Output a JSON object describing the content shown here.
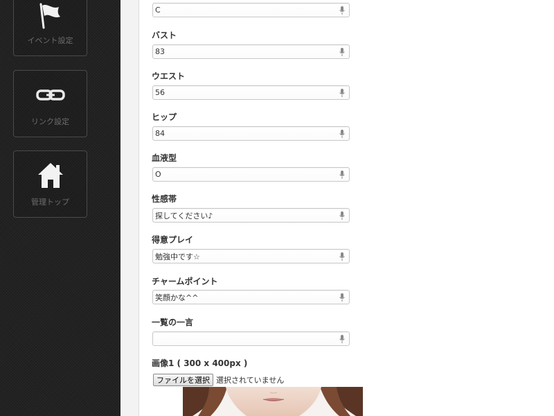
{
  "sidebar": {
    "items": [
      {
        "label": "イベント設定",
        "icon": "flag-icon"
      },
      {
        "label": "リンク設定",
        "icon": "link-icon"
      },
      {
        "label": "管理トップ",
        "icon": "home-icon"
      }
    ]
  },
  "form": {
    "fields": [
      {
        "label": "",
        "value": "C"
      },
      {
        "label": "バスト",
        "value": "83"
      },
      {
        "label": "ウエスト",
        "value": "56"
      },
      {
        "label": "ヒップ",
        "value": "84"
      },
      {
        "label": "血液型",
        "value": "O"
      },
      {
        "label": "性感帯",
        "value": "探してください♪"
      },
      {
        "label": "得意プレイ",
        "value": "勉強中です☆"
      },
      {
        "label": "チャームポイント",
        "value": "笑顔かな^^"
      },
      {
        "label": "一覧の一言",
        "value": ""
      }
    ],
    "image1": {
      "label": "画像1 ( 300 x 400px )",
      "button": "ファイルを選択",
      "status": "選択されていません"
    }
  },
  "colors": {
    "sidebar_bg": "#222222",
    "nav_border": "#4a4a4a",
    "nav_label": "#6d6d6d",
    "field_border": "#c8c8c8"
  }
}
